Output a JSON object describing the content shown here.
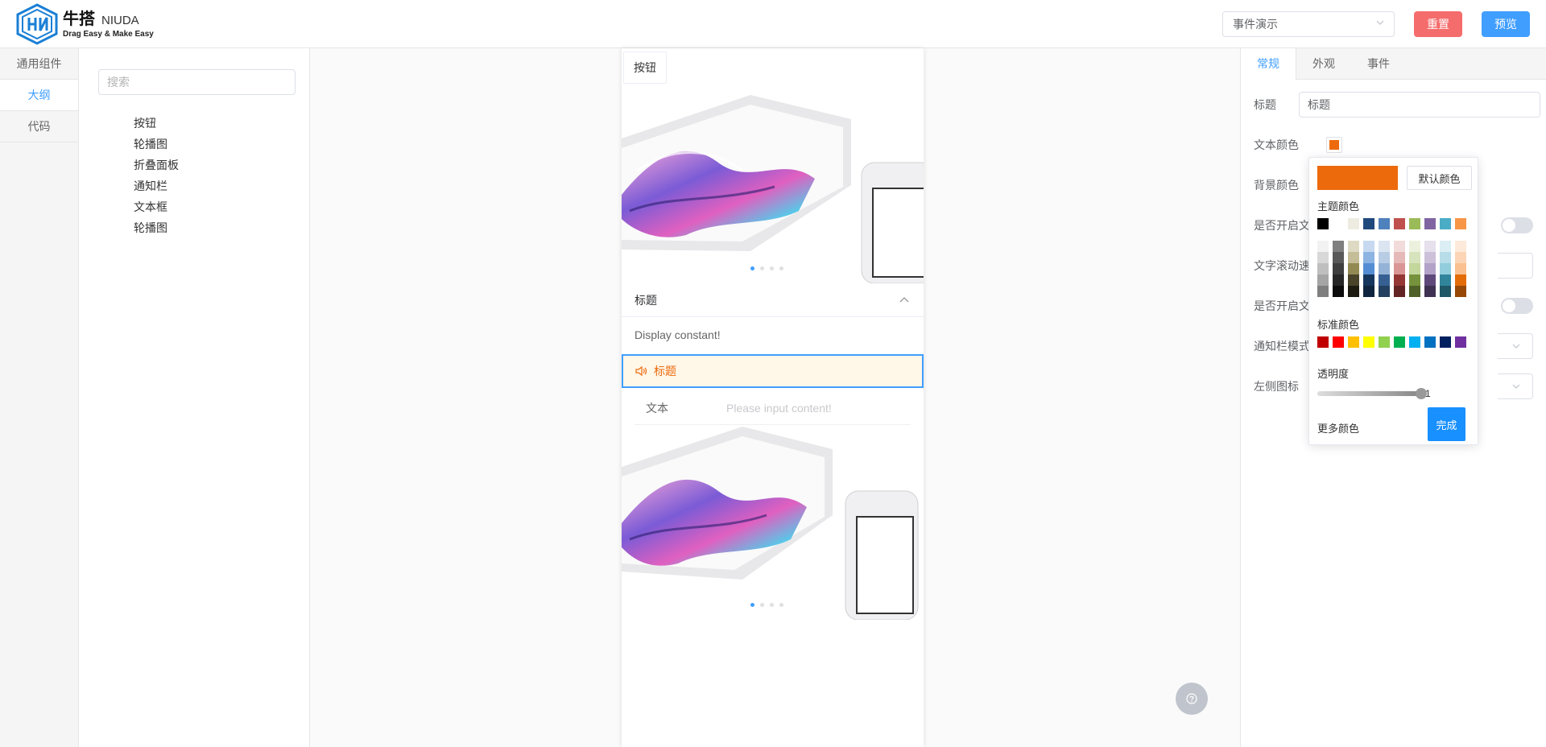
{
  "header": {
    "logo_cn": "牛搭",
    "logo_en": "NIUDA",
    "logo_slogan": "Drag Easy & Make Easy",
    "event_select": "事件演示",
    "reset_label": "重置",
    "preview_label": "预览"
  },
  "leftnav": {
    "items": [
      {
        "label": "通用组件",
        "active": false
      },
      {
        "label": "大纲",
        "active": true
      },
      {
        "label": "代码",
        "active": false
      }
    ]
  },
  "outline": {
    "search_placeholder": "搜索",
    "items": [
      "按钮",
      "轮播图",
      "折叠面板",
      "通知栏",
      "文本框",
      "轮播图"
    ]
  },
  "canvas": {
    "button_label": "按钮",
    "collapse_title": "标题",
    "collapse_content": "Display constant!",
    "notice_text": "标题",
    "field_label": "文本",
    "field_placeholder": "Please input content!",
    "help_icon": "question-icon"
  },
  "rpanel": {
    "tabs": [
      {
        "label": "常规",
        "active": true
      },
      {
        "label": "外观",
        "active": false
      },
      {
        "label": "事件",
        "active": false
      }
    ],
    "title_label": "标题",
    "title_value": "标题",
    "text_color_label": "文本颜色",
    "text_color_value": "#ed6a0c",
    "bg_color_label": "背景颜色",
    "rows_partial": [
      "是否开启文",
      "文字滚动速",
      "是否开启文",
      "通知栏模式",
      "左侧图标"
    ]
  },
  "picker": {
    "current_color": "#ed6a0c",
    "default_label": "默认颜色",
    "theme_label": "主题颜色",
    "standard_label": "标准颜色",
    "opacity_label": "透明度",
    "opacity_value": "1",
    "more_label": "更多颜色",
    "done_label": "完成",
    "theme_colors": [
      "#000000",
      "#ffffff",
      "#eeece1",
      "#1f497d",
      "#4f81bd",
      "#c0504d",
      "#9bbb59",
      "#8064a2",
      "#4bacc6",
      "#f79646"
    ],
    "theme_shades": [
      [
        "#f2f2f2",
        "#d8d8d8",
        "#bfbfbf",
        "#a5a5a5",
        "#7f7f7f"
      ],
      [
        "#7f7f7f",
        "#595959",
        "#3f3f3f",
        "#262626",
        "#0c0c0c"
      ],
      [
        "#ddd9c3",
        "#c4bd97",
        "#938953",
        "#494429",
        "#1d1b10"
      ],
      [
        "#c6d9f0",
        "#8db3e2",
        "#548dd4",
        "#17365d",
        "#0f243e"
      ],
      [
        "#dbe5f1",
        "#b8cce4",
        "#95b3d7",
        "#366092",
        "#244061"
      ],
      [
        "#f2dcdb",
        "#e5b9b7",
        "#d99694",
        "#953734",
        "#632423"
      ],
      [
        "#ebf1dd",
        "#d7e3bc",
        "#c3d69b",
        "#76923c",
        "#4f6128"
      ],
      [
        "#e5e0ec",
        "#ccc1d9",
        "#b2a2c7",
        "#5f497a",
        "#3f3151"
      ],
      [
        "#dbeef3",
        "#b7dde8",
        "#92cddc",
        "#31859b",
        "#205867"
      ],
      [
        "#fdeada",
        "#fbd5b5",
        "#fac08f",
        "#e36c09",
        "#974806"
      ]
    ],
    "standard_colors": [
      "#c00000",
      "#ff0000",
      "#ffc000",
      "#ffff00",
      "#92d050",
      "#00b050",
      "#00b0f0",
      "#0070c0",
      "#002060",
      "#7030a0"
    ]
  }
}
